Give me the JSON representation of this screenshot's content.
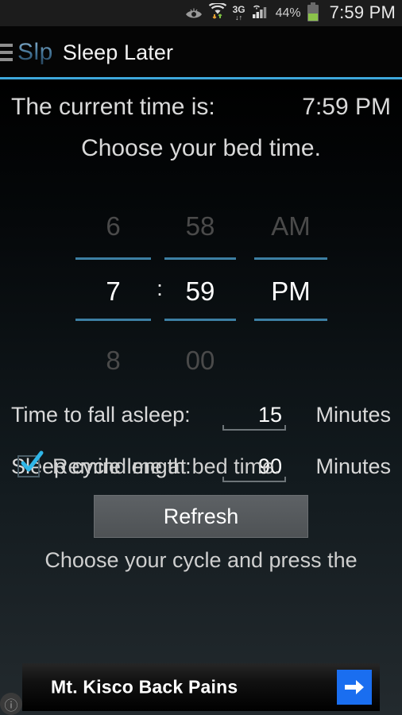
{
  "status_bar": {
    "icons": [
      "eye-icon",
      "wifi-icon",
      "3g-icon",
      "signal-icon"
    ],
    "network_label": "3G",
    "battery_percent": "44%",
    "battery_level": 44,
    "clock": "7:59 PM"
  },
  "action_bar": {
    "menu_icon": "hamburger-icon",
    "logo": "Slp",
    "title": "Sleep Later",
    "accent_color": "#3ea8dc"
  },
  "main": {
    "current_time_label": "The current time is:",
    "current_time_value": "7:59 PM",
    "instruction": "Choose your bed time.",
    "picker": {
      "hour": {
        "prev": "6",
        "current": "7",
        "next": "8"
      },
      "separator": ":",
      "minute": {
        "prev": "58",
        "current": "59",
        "next": "00"
      },
      "meridiem": {
        "prev": "AM",
        "current": "PM",
        "next": ""
      },
      "line_color": "#3d7fa3"
    },
    "fall_asleep": {
      "label": "Time to fall asleep:",
      "value": "15",
      "unit": "Minutes"
    },
    "cycle_length": {
      "label": "Sleep cycle length:",
      "value": "90",
      "unit": "Minutes"
    },
    "remind": {
      "label": "Remind me at bed time.",
      "checked": true,
      "check_color": "#2fb6e8"
    },
    "refresh_label": "Refresh",
    "hint_text": "Choose your cycle and press the"
  },
  "ad": {
    "headline": "Mt. Kisco Back Pains",
    "arrow_icon": "arrow-right-icon",
    "info_icon": "info-icon",
    "arrow_color": "#1a6ef0"
  }
}
